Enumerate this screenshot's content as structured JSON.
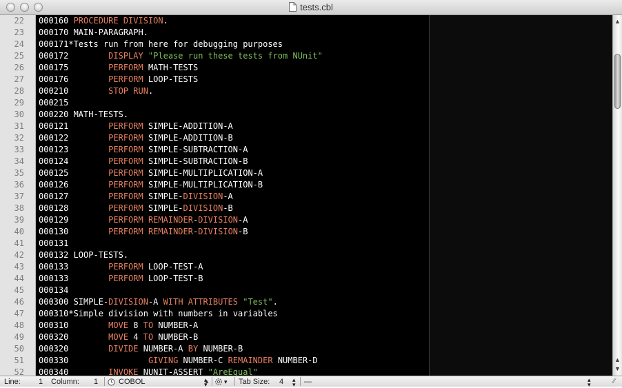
{
  "window": {
    "title": "tests.cbl"
  },
  "gutter": {
    "line_numbers": [
      "22",
      "23",
      "24",
      "25",
      "26",
      "27",
      "28",
      "29",
      "30",
      "31",
      "32",
      "33",
      "34",
      "35",
      "36",
      "37",
      "38",
      "39",
      "40",
      "41",
      "42",
      "43",
      "44",
      "45",
      "46",
      "47",
      "48",
      "49",
      "50",
      "51",
      "52"
    ]
  },
  "code_lines": [
    [
      {
        "t": "000160 ",
        "c": "n"
      },
      {
        "t": "PROCEDURE DIVISION",
        "c": "k"
      },
      {
        "t": ".",
        "c": "n"
      }
    ],
    [
      {
        "t": "000170 MAIN-PARAGRAPH.",
        "c": "n"
      }
    ],
    [
      {
        "t": "000171*Tests run from here for debugging purposes",
        "c": "n"
      }
    ],
    [
      {
        "t": "000172        ",
        "c": "n"
      },
      {
        "t": "DISPLAY ",
        "c": "k"
      },
      {
        "t": "\"Please run these tests from NUnit\"",
        "c": "s"
      }
    ],
    [
      {
        "t": "000175        ",
        "c": "n"
      },
      {
        "t": "PERFORM ",
        "c": "k"
      },
      {
        "t": "MATH-TESTS",
        "c": "n"
      }
    ],
    [
      {
        "t": "000176        ",
        "c": "n"
      },
      {
        "t": "PERFORM ",
        "c": "k"
      },
      {
        "t": "LOOP-TESTS",
        "c": "n"
      }
    ],
    [
      {
        "t": "000210        ",
        "c": "n"
      },
      {
        "t": "STOP RUN",
        "c": "k"
      },
      {
        "t": ".",
        "c": "n"
      }
    ],
    [
      {
        "t": "000215",
        "c": "n"
      }
    ],
    [
      {
        "t": "000220 MATH-TESTS.",
        "c": "n"
      }
    ],
    [
      {
        "t": "000121        ",
        "c": "n"
      },
      {
        "t": "PERFORM ",
        "c": "k"
      },
      {
        "t": "SIMPLE-ADDITION-A",
        "c": "n"
      }
    ],
    [
      {
        "t": "000122        ",
        "c": "n"
      },
      {
        "t": "PERFORM ",
        "c": "k"
      },
      {
        "t": "SIMPLE-ADDITION-B",
        "c": "n"
      }
    ],
    [
      {
        "t": "000123        ",
        "c": "n"
      },
      {
        "t": "PERFORM ",
        "c": "k"
      },
      {
        "t": "SIMPLE-SUBTRACTION-A",
        "c": "n"
      }
    ],
    [
      {
        "t": "000124        ",
        "c": "n"
      },
      {
        "t": "PERFORM ",
        "c": "k"
      },
      {
        "t": "SIMPLE-SUBTRACTION-B",
        "c": "n"
      }
    ],
    [
      {
        "t": "000125        ",
        "c": "n"
      },
      {
        "t": "PERFORM ",
        "c": "k"
      },
      {
        "t": "SIMPLE-MULTIPLICATION-A",
        "c": "n"
      }
    ],
    [
      {
        "t": "000126        ",
        "c": "n"
      },
      {
        "t": "PERFORM ",
        "c": "k"
      },
      {
        "t": "SIMPLE-MULTIPLICATION-B",
        "c": "n"
      }
    ],
    [
      {
        "t": "000127        ",
        "c": "n"
      },
      {
        "t": "PERFORM ",
        "c": "k"
      },
      {
        "t": "SIMPLE-",
        "c": "n"
      },
      {
        "t": "DIVISION",
        "c": "k"
      },
      {
        "t": "-A",
        "c": "n"
      }
    ],
    [
      {
        "t": "000128        ",
        "c": "n"
      },
      {
        "t": "PERFORM ",
        "c": "k"
      },
      {
        "t": "SIMPLE-",
        "c": "n"
      },
      {
        "t": "DIVISION",
        "c": "k"
      },
      {
        "t": "-B",
        "c": "n"
      }
    ],
    [
      {
        "t": "000129        ",
        "c": "n"
      },
      {
        "t": "PERFORM REMAINDER",
        "c": "k"
      },
      {
        "t": "-",
        "c": "n"
      },
      {
        "t": "DIVISION",
        "c": "k"
      },
      {
        "t": "-A",
        "c": "n"
      }
    ],
    [
      {
        "t": "000130        ",
        "c": "n"
      },
      {
        "t": "PERFORM REMAINDER",
        "c": "k"
      },
      {
        "t": "-",
        "c": "n"
      },
      {
        "t": "DIVISION",
        "c": "k"
      },
      {
        "t": "-B",
        "c": "n"
      }
    ],
    [
      {
        "t": "000131",
        "c": "n"
      }
    ],
    [
      {
        "t": "000132 LOOP-TESTS.",
        "c": "n"
      }
    ],
    [
      {
        "t": "000133        ",
        "c": "n"
      },
      {
        "t": "PERFORM ",
        "c": "k"
      },
      {
        "t": "LOOP-TEST-A",
        "c": "n"
      }
    ],
    [
      {
        "t": "000133        ",
        "c": "n"
      },
      {
        "t": "PERFORM ",
        "c": "k"
      },
      {
        "t": "LOOP-TEST-B",
        "c": "n"
      }
    ],
    [
      {
        "t": "000134",
        "c": "n"
      }
    ],
    [
      {
        "t": "000300 SIMPLE-",
        "c": "n"
      },
      {
        "t": "DIVISION",
        "c": "k"
      },
      {
        "t": "-A ",
        "c": "n"
      },
      {
        "t": "WITH ATTRIBUTES ",
        "c": "k"
      },
      {
        "t": "\"Test\"",
        "c": "s"
      },
      {
        "t": ".",
        "c": "n"
      }
    ],
    [
      {
        "t": "000310*Simple division with numbers in variables",
        "c": "n"
      }
    ],
    [
      {
        "t": "000310        ",
        "c": "n"
      },
      {
        "t": "MOVE ",
        "c": "k"
      },
      {
        "t": "8 ",
        "c": "n"
      },
      {
        "t": "TO ",
        "c": "k"
      },
      {
        "t": "NUMBER-A",
        "c": "n"
      }
    ],
    [
      {
        "t": "000320        ",
        "c": "n"
      },
      {
        "t": "MOVE ",
        "c": "k"
      },
      {
        "t": "4 ",
        "c": "n"
      },
      {
        "t": "TO ",
        "c": "k"
      },
      {
        "t": "NUMBER-B",
        "c": "n"
      }
    ],
    [
      {
        "t": "000320        ",
        "c": "n"
      },
      {
        "t": "DIVIDE ",
        "c": "k"
      },
      {
        "t": "NUMBER-A ",
        "c": "n"
      },
      {
        "t": "BY ",
        "c": "k"
      },
      {
        "t": "NUMBER-B",
        "c": "n"
      }
    ],
    [
      {
        "t": "000330                ",
        "c": "n"
      },
      {
        "t": "GIVING ",
        "c": "k"
      },
      {
        "t": "NUMBER-C ",
        "c": "n"
      },
      {
        "t": "REMAINDER ",
        "c": "k"
      },
      {
        "t": "NUMBER-D",
        "c": "n"
      }
    ],
    [
      {
        "t": "000340        ",
        "c": "n"
      },
      {
        "t": "INVOKE ",
        "c": "k"
      },
      {
        "t": "NUNIT-ASSERT ",
        "c": "n"
      },
      {
        "t": "\"AreEqual\"",
        "c": "s"
      }
    ]
  ],
  "status": {
    "line_label": "Line:",
    "line_value": "1",
    "column_label": "Column:",
    "column_value": "1",
    "language": "COBOL",
    "tab_size_label": "Tab Size:",
    "tab_size_value": "4",
    "symbol_value": "—"
  },
  "colors": {
    "keyword": "#e8805f",
    "string": "#7fbf5f",
    "text": "#ffffff",
    "background": "#000000"
  }
}
